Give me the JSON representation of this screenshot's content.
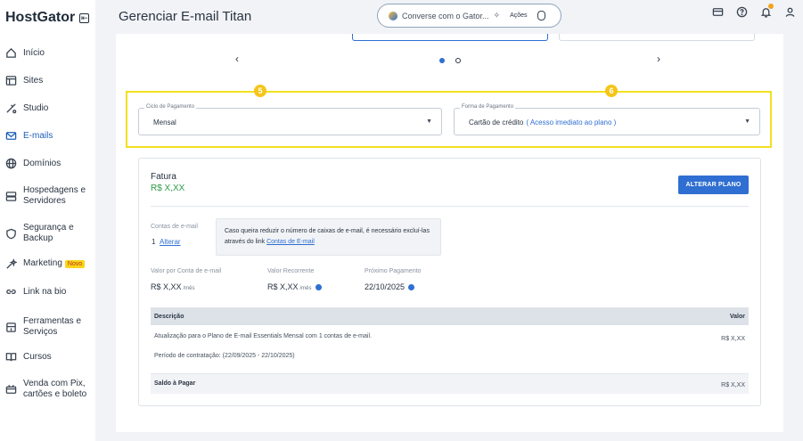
{
  "brand": {
    "name": "HostGator",
    "collapse_icon": "sidebar-collapse-icon"
  },
  "sidebar": {
    "items": [
      {
        "label": "Início",
        "icon": "home-icon"
      },
      {
        "label": "Sites",
        "icon": "browser-icon"
      },
      {
        "label": "Studio",
        "icon": "studio-icon"
      },
      {
        "label": "E-mails",
        "icon": "mail-icon",
        "active": true
      },
      {
        "label": "Domínios",
        "icon": "globe-icon"
      },
      {
        "label": "Hospedagens e Servidores",
        "icon": "server-icon"
      },
      {
        "label": "Segurança e Backup",
        "icon": "shield-icon"
      },
      {
        "label": "Marketing",
        "icon": "sparkle-icon",
        "badge": "Novo"
      },
      {
        "label": "Link na bio",
        "icon": "link-icon"
      },
      {
        "label": "Ferramentas e Serviços",
        "icon": "tools-icon"
      },
      {
        "label": "Cursos",
        "icon": "book-icon"
      },
      {
        "label": "Venda com Pix, cartões e boleto",
        "icon": "payment-icon"
      }
    ]
  },
  "header": {
    "title": "Gerenciar E-mail Titan",
    "chat_placeholder": "Converse com o Gator...",
    "actions_label": "Ações"
  },
  "carousel": {
    "prev": "‹",
    "next": "›"
  },
  "steps": {
    "five": "5",
    "six": "6"
  },
  "payment_cycle": {
    "legend": "Ciclo de Pagamento",
    "value": "Mensal"
  },
  "payment_method": {
    "legend": "Forma de Pagamento",
    "value": "Cartão de crédito",
    "hint": "( Acesso imediato ao plano )"
  },
  "invoice": {
    "title": "Fatura",
    "amount": "R$ X,XX",
    "change_plan_button": "ALTERAR PLANO",
    "accounts_label": "Contas de e-mail",
    "accounts_count": "1",
    "accounts_change_link": "Alterar",
    "notice_text": "Caso queira reduzir o número de caixas de e-mail, é necessário excluí-las através do link",
    "notice_link": "Contas de E-mail",
    "per_account_label": "Valor por Conta de e-mail",
    "per_account_value": "R$ X,XX",
    "per_account_unit": "/mês",
    "recurring_label": "Valor Recorrente",
    "recurring_value": "R$ X,XX",
    "recurring_unit": "/mês",
    "next_payment_label": "Próximo Pagamento",
    "next_payment_value": "22/10/2025"
  },
  "table": {
    "col_description": "Descrição",
    "col_value": "Valor",
    "row_line1": "Atualização para o Plano de E-mail Essentials Mensal com 1 contas de e-mail.",
    "row_line2": "Período de contratação: (22/09/2025 - 22/10/2025)",
    "row_value": "R$ X,XX",
    "footer_label": "Saldo à Pagar",
    "footer_value": "R$ X,XX"
  }
}
